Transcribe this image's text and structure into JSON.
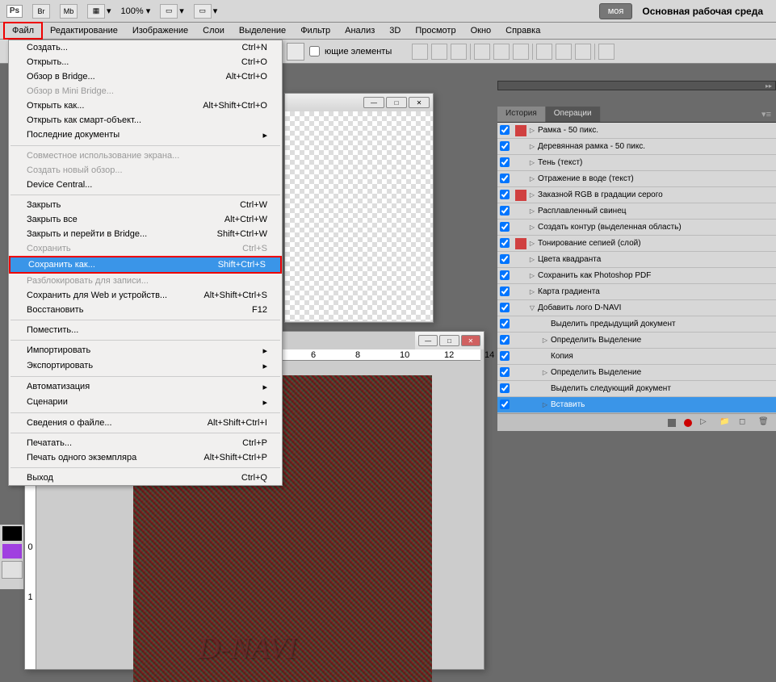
{
  "toolbar": {
    "zoom": "100%",
    "my_button": "моя",
    "workspace": "Основная рабочая среда",
    "mb_label": "Mb",
    "br_label": "Br"
  },
  "menubar": [
    "Файл",
    "Редактирование",
    "Изображение",
    "Слои",
    "Выделение",
    "Фильтр",
    "Анализ",
    "3D",
    "Просмотр",
    "Окно",
    "Справка"
  ],
  "optionsbar": {
    "show_tools": "ющие элементы"
  },
  "file_menu": [
    {
      "label": "Создать...",
      "shortcut": "Ctrl+N",
      "type": "item"
    },
    {
      "label": "Открыть...",
      "shortcut": "Ctrl+O",
      "type": "item"
    },
    {
      "label": "Обзор в Bridge...",
      "shortcut": "Alt+Ctrl+O",
      "type": "item"
    },
    {
      "label": "Обзор в Mini Bridge...",
      "shortcut": "",
      "type": "disabled"
    },
    {
      "label": "Открыть как...",
      "shortcut": "Alt+Shift+Ctrl+O",
      "type": "item"
    },
    {
      "label": "Открыть как смарт-объект...",
      "shortcut": "",
      "type": "item"
    },
    {
      "label": "Последние документы",
      "shortcut": "",
      "type": "submenu"
    },
    {
      "type": "sep"
    },
    {
      "label": "Совместное использование экрана...",
      "shortcut": "",
      "type": "disabled"
    },
    {
      "label": "Создать новый обзор...",
      "shortcut": "",
      "type": "disabled"
    },
    {
      "label": "Device Central...",
      "shortcut": "",
      "type": "item"
    },
    {
      "type": "sep"
    },
    {
      "label": "Закрыть",
      "shortcut": "Ctrl+W",
      "type": "item"
    },
    {
      "label": "Закрыть все",
      "shortcut": "Alt+Ctrl+W",
      "type": "item"
    },
    {
      "label": "Закрыть и перейти в Bridge...",
      "shortcut": "Shift+Ctrl+W",
      "type": "item"
    },
    {
      "label": "Сохранить",
      "shortcut": "Ctrl+S",
      "type": "disabled"
    },
    {
      "label": "Сохранить как...",
      "shortcut": "Shift+Ctrl+S",
      "type": "highlighted"
    },
    {
      "label": "Разблокировать для записи...",
      "shortcut": "",
      "type": "disabled"
    },
    {
      "label": "Сохранить для Web и устройств...",
      "shortcut": "Alt+Shift+Ctrl+S",
      "type": "item"
    },
    {
      "label": "Восстановить",
      "shortcut": "F12",
      "type": "item"
    },
    {
      "type": "sep"
    },
    {
      "label": "Поместить...",
      "shortcut": "",
      "type": "item"
    },
    {
      "type": "sep"
    },
    {
      "label": "Импортировать",
      "shortcut": "",
      "type": "submenu"
    },
    {
      "label": "Экспортировать",
      "shortcut": "",
      "type": "submenu"
    },
    {
      "type": "sep"
    },
    {
      "label": "Автоматизация",
      "shortcut": "",
      "type": "submenu"
    },
    {
      "label": "Сценарии",
      "shortcut": "",
      "type": "submenu"
    },
    {
      "type": "sep"
    },
    {
      "label": "Сведения о файле...",
      "shortcut": "Alt+Shift+Ctrl+I",
      "type": "item"
    },
    {
      "type": "sep"
    },
    {
      "label": "Печатать...",
      "shortcut": "Ctrl+P",
      "type": "item"
    },
    {
      "label": "Печать одного экземпляра",
      "shortcut": "Alt+Shift+Ctrl+P",
      "type": "item"
    },
    {
      "type": "sep"
    },
    {
      "label": "Выход",
      "shortcut": "Ctrl+Q",
      "type": "item"
    }
  ],
  "panels": {
    "tabs": [
      "История",
      "Операции"
    ],
    "active_tab": 1,
    "actions": [
      {
        "check": true,
        "icon": "red",
        "tri": "▷",
        "txt": "Рамка - 50 пикс.",
        "indent": 0
      },
      {
        "check": true,
        "icon": "",
        "tri": "▷",
        "txt": "Деревянная рамка - 50 пикс.",
        "indent": 0
      },
      {
        "check": true,
        "icon": "",
        "tri": "▷",
        "txt": "Тень (текст)",
        "indent": 0
      },
      {
        "check": true,
        "icon": "",
        "tri": "▷",
        "txt": "Отражение в воде (текст)",
        "indent": 0
      },
      {
        "check": true,
        "icon": "red",
        "tri": "▷",
        "txt": "Заказной RGB в градации серого",
        "indent": 0
      },
      {
        "check": true,
        "icon": "",
        "tri": "▷",
        "txt": "Расплавленный свинец",
        "indent": 0
      },
      {
        "check": true,
        "icon": "",
        "tri": "▷",
        "txt": "Создать контур (выделенная область)",
        "indent": 0
      },
      {
        "check": true,
        "icon": "red",
        "tri": "▷",
        "txt": "Тонирование сепией (слой)",
        "indent": 0
      },
      {
        "check": true,
        "icon": "",
        "tri": "▷",
        "txt": "Цвета квадранта",
        "indent": 0
      },
      {
        "check": true,
        "icon": "",
        "tri": "▷",
        "txt": "Сохранить как Photoshop PDF",
        "indent": 0
      },
      {
        "check": true,
        "icon": "",
        "tri": "▷",
        "txt": "Карта градиента",
        "indent": 0
      },
      {
        "check": true,
        "icon": "",
        "tri": "▽",
        "txt": "Добавить лого D-NAVI",
        "indent": 0
      },
      {
        "check": true,
        "icon": "",
        "tri": "",
        "txt": "Выделить  предыдущий документ",
        "indent": 1
      },
      {
        "check": true,
        "icon": "",
        "tri": "▷",
        "txt": "Определить Выделение",
        "indent": 1
      },
      {
        "check": true,
        "icon": "",
        "tri": "",
        "txt": "Копия",
        "indent": 1
      },
      {
        "check": true,
        "icon": "",
        "tri": "▷",
        "txt": "Определить Выделение",
        "indent": 1
      },
      {
        "check": true,
        "icon": "",
        "tri": "",
        "txt": "Выделить  следующий документ",
        "indent": 1
      },
      {
        "check": true,
        "icon": "",
        "tri": "▷",
        "txt": "Вставить",
        "indent": 1,
        "selected": true
      }
    ]
  },
  "ruler_h": [
    "6",
    "8",
    "10",
    "12",
    "14"
  ],
  "ruler_v": [
    "0",
    "1"
  ],
  "watermark": "D-NAVI"
}
